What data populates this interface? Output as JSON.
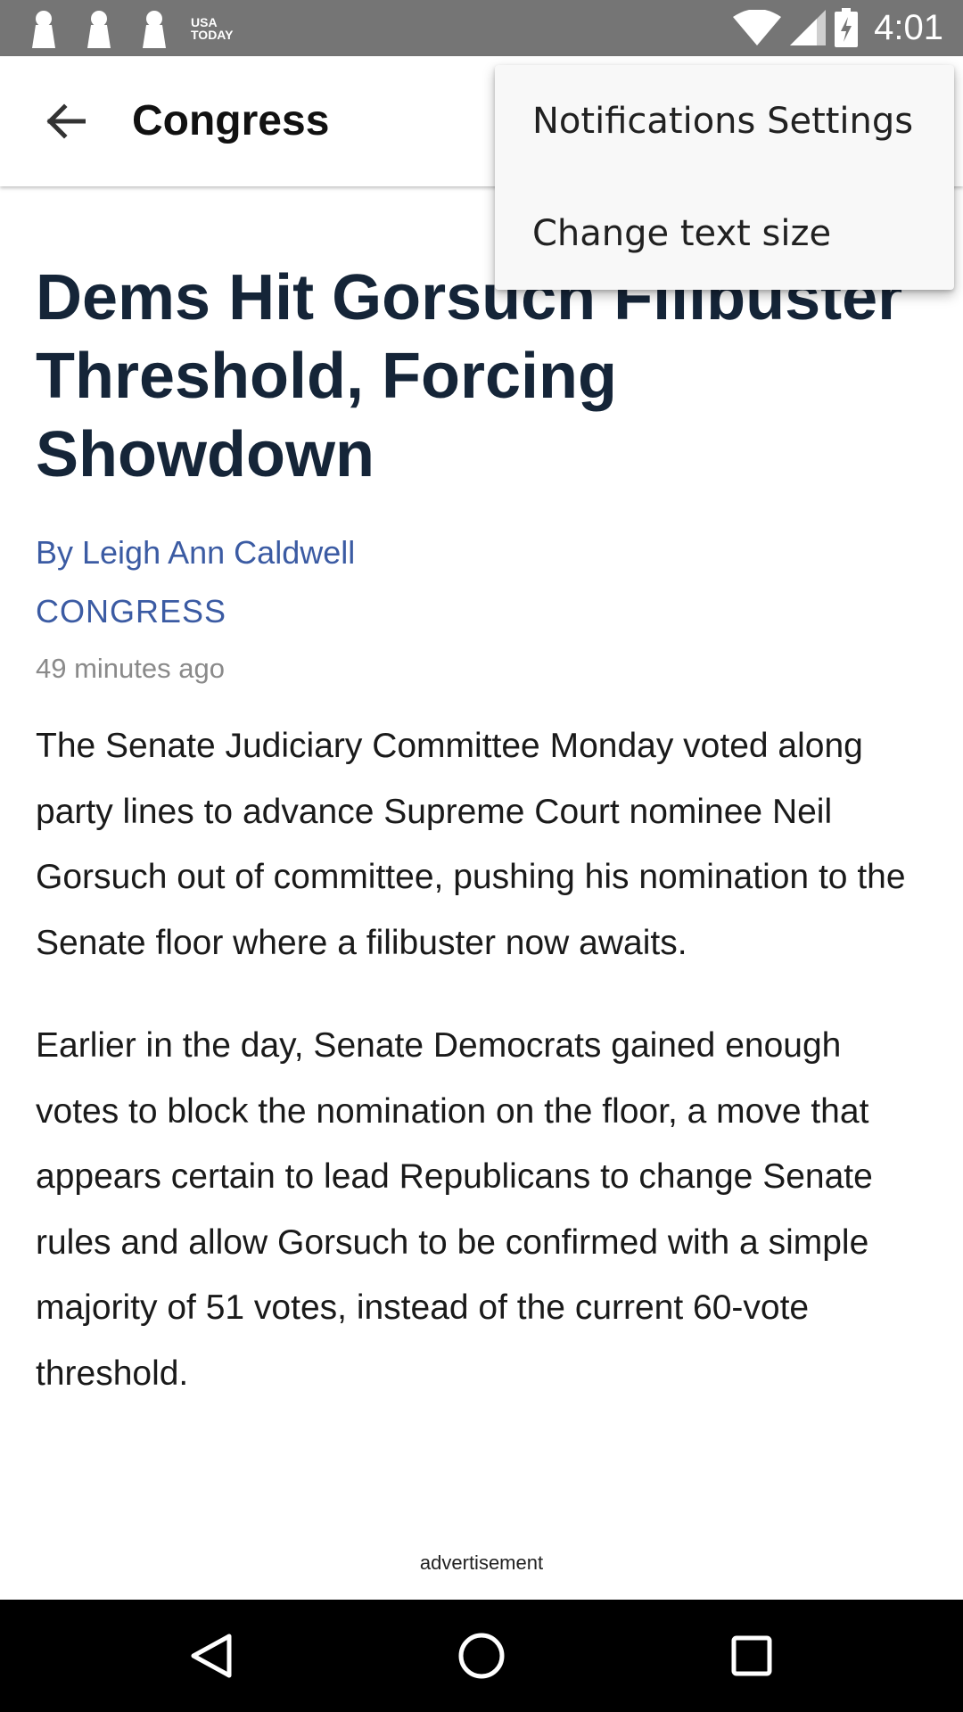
{
  "status_bar": {
    "notification_logo_text": "USA TODAY",
    "time": "4:01",
    "icons": [
      "keyhole-icon",
      "keyhole-icon",
      "keyhole-icon",
      "usa-today-logo",
      "wifi-icon",
      "signal-icon",
      "battery-charging-icon"
    ]
  },
  "app_bar": {
    "title": "Congress",
    "back_icon": "arrow-back-icon"
  },
  "menu": {
    "items": [
      {
        "label": "Notifications Settings"
      },
      {
        "label": "Change text size"
      }
    ]
  },
  "article": {
    "headline": "Dems Hit Gorsuch Filibuster Threshold, Forcing Showdown",
    "byline": "By Leigh Ann Caldwell",
    "section": "CONGRESS",
    "timestamp": "49 minutes ago",
    "paragraphs": [
      "The Senate Judiciary Committee Monday voted along party lines to advance Supreme Court nominee Neil Gorsuch out of committee, pushing his nomination to the Senate floor where a filibuster now awaits.",
      "Earlier in the day, Senate Democrats gained enough votes to block the nomination on the floor, a move that appears certain to lead Republicans to change Senate rules and allow Gorsuch to be confirmed with a simple majority of 51 votes, instead of the current 60-vote threshold."
    ],
    "ad_label": "advertisement"
  },
  "nav_bar": {
    "icons": [
      "back-triangle-icon",
      "home-circle-icon",
      "recents-square-icon"
    ]
  },
  "colors": {
    "status_bar": "#757575",
    "headline": "#152538",
    "link": "#3b5ba3",
    "timestamp": "#8a8a8a",
    "menu_bg": "#f8f8f8"
  }
}
